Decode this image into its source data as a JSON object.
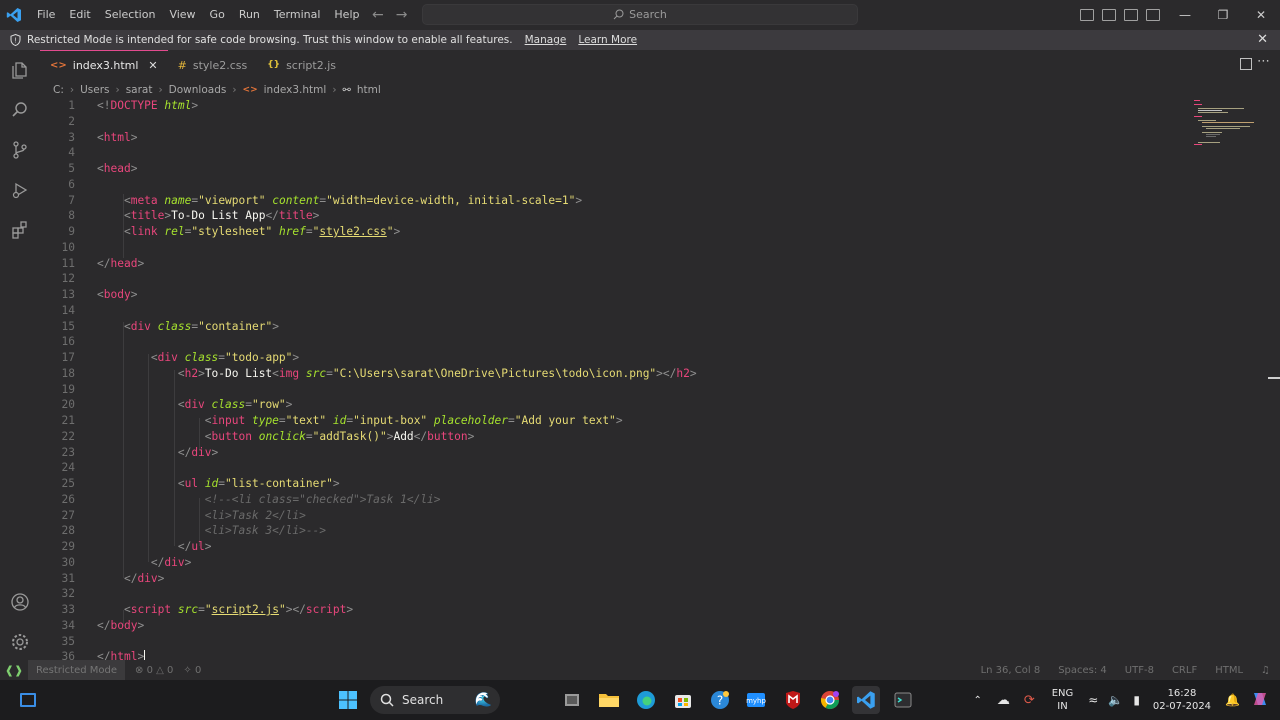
{
  "menu": [
    "File",
    "Edit",
    "Selection",
    "View",
    "Go",
    "Run",
    "Terminal",
    "Help"
  ],
  "search": {
    "label": "Search"
  },
  "banner": {
    "message": "Restricted Mode is intended for safe code browsing. Trust this window to enable all features.",
    "manage": "Manage",
    "learn_more": "Learn More"
  },
  "tabs": [
    {
      "label": "index3.html",
      "icon": "html-icon",
      "active": true
    },
    {
      "label": "style2.css",
      "icon": "css-icon",
      "active": false
    },
    {
      "label": "script2.js",
      "icon": "js-icon",
      "active": false
    }
  ],
  "breadcrumb": [
    "C:",
    "Users",
    "sarat",
    "Downloads",
    "index3.html",
    "html"
  ],
  "editor": {
    "lines": [
      [
        [
          "punc",
          "<!"
        ],
        [
          "tag",
          "DOCTYPE"
        ],
        [
          "txt",
          " "
        ],
        [
          "attr",
          "html"
        ],
        [
          "punc",
          ">"
        ]
      ],
      [],
      [
        [
          "punc",
          "<"
        ],
        [
          "tag",
          "html"
        ],
        [
          "punc",
          ">"
        ]
      ],
      [],
      [
        [
          "punc",
          "<"
        ],
        [
          "tag",
          "head"
        ],
        [
          "punc",
          ">"
        ]
      ],
      [],
      [
        [
          "txt",
          "    "
        ],
        [
          "punc",
          "<"
        ],
        [
          "tag",
          "meta"
        ],
        [
          "txt",
          " "
        ],
        [
          "attr",
          "name"
        ],
        [
          "punc",
          "="
        ],
        [
          "str",
          "\"viewport\""
        ],
        [
          "txt",
          " "
        ],
        [
          "attr",
          "content"
        ],
        [
          "punc",
          "="
        ],
        [
          "str",
          "\"width=device-width, initial-scale=1\""
        ],
        [
          "punc",
          ">"
        ]
      ],
      [
        [
          "txt",
          "    "
        ],
        [
          "punc",
          "<"
        ],
        [
          "tag",
          "title"
        ],
        [
          "punc",
          ">"
        ],
        [
          "txt",
          "To-Do List App"
        ],
        [
          "punc",
          "</"
        ],
        [
          "tag",
          "title"
        ],
        [
          "punc",
          ">"
        ]
      ],
      [
        [
          "txt",
          "    "
        ],
        [
          "punc",
          "<"
        ],
        [
          "tag",
          "link"
        ],
        [
          "txt",
          " "
        ],
        [
          "attr",
          "rel"
        ],
        [
          "punc",
          "="
        ],
        [
          "str",
          "\"stylesheet\""
        ],
        [
          "txt",
          " "
        ],
        [
          "attr",
          "href"
        ],
        [
          "punc",
          "="
        ],
        [
          "str",
          "\""
        ],
        [
          "link",
          "style2.css"
        ],
        [
          "str",
          "\""
        ],
        [
          "punc",
          ">"
        ]
      ],
      [],
      [
        [
          "punc",
          "</"
        ],
        [
          "tag",
          "head"
        ],
        [
          "punc",
          ">"
        ]
      ],
      [],
      [
        [
          "punc",
          "<"
        ],
        [
          "tag",
          "body"
        ],
        [
          "punc",
          ">"
        ]
      ],
      [],
      [
        [
          "txt",
          "    "
        ],
        [
          "punc",
          "<"
        ],
        [
          "tag",
          "div"
        ],
        [
          "txt",
          " "
        ],
        [
          "attr",
          "class"
        ],
        [
          "punc",
          "="
        ],
        [
          "str",
          "\"container\""
        ],
        [
          "punc",
          ">"
        ]
      ],
      [],
      [
        [
          "txt",
          "        "
        ],
        [
          "punc",
          "<"
        ],
        [
          "tag",
          "div"
        ],
        [
          "txt",
          " "
        ],
        [
          "attr",
          "class"
        ],
        [
          "punc",
          "="
        ],
        [
          "str",
          "\"todo-app\""
        ],
        [
          "punc",
          ">"
        ]
      ],
      [
        [
          "txt",
          "            "
        ],
        [
          "punc",
          "<"
        ],
        [
          "tag",
          "h2"
        ],
        [
          "punc",
          ">"
        ],
        [
          "txt",
          "To-Do List"
        ],
        [
          "punc",
          "<"
        ],
        [
          "tag",
          "img"
        ],
        [
          "txt",
          " "
        ],
        [
          "attr",
          "src"
        ],
        [
          "punc",
          "="
        ],
        [
          "str",
          "\"C:\\Users\\sarat\\OneDrive\\Pictures\\todo\\icon.png\""
        ],
        [
          "punc",
          "></"
        ],
        [
          "tag",
          "h2"
        ],
        [
          "punc",
          ">"
        ]
      ],
      [],
      [
        [
          "txt",
          "            "
        ],
        [
          "punc",
          "<"
        ],
        [
          "tag",
          "div"
        ],
        [
          "txt",
          " "
        ],
        [
          "attr",
          "class"
        ],
        [
          "punc",
          "="
        ],
        [
          "str",
          "\"row\""
        ],
        [
          "punc",
          ">"
        ]
      ],
      [
        [
          "txt",
          "                "
        ],
        [
          "punc",
          "<"
        ],
        [
          "tag",
          "input"
        ],
        [
          "txt",
          " "
        ],
        [
          "attr",
          "type"
        ],
        [
          "punc",
          "="
        ],
        [
          "str",
          "\"text\""
        ],
        [
          "txt",
          " "
        ],
        [
          "attr",
          "id"
        ],
        [
          "punc",
          "="
        ],
        [
          "str",
          "\"input-box\""
        ],
        [
          "txt",
          " "
        ],
        [
          "attr",
          "placeholder"
        ],
        [
          "punc",
          "="
        ],
        [
          "str",
          "\"Add your text\""
        ],
        [
          "punc",
          ">"
        ]
      ],
      [
        [
          "txt",
          "                "
        ],
        [
          "punc",
          "<"
        ],
        [
          "tag",
          "button"
        ],
        [
          "txt",
          " "
        ],
        [
          "attr",
          "onclick"
        ],
        [
          "punc",
          "="
        ],
        [
          "str",
          "\"addTask()\""
        ],
        [
          "punc",
          ">"
        ],
        [
          "txt",
          "Add"
        ],
        [
          "punc",
          "</"
        ],
        [
          "tag",
          "button"
        ],
        [
          "punc",
          ">"
        ]
      ],
      [
        [
          "txt",
          "            "
        ],
        [
          "punc",
          "</"
        ],
        [
          "tag",
          "div"
        ],
        [
          "punc",
          ">"
        ]
      ],
      [],
      [
        [
          "txt",
          "            "
        ],
        [
          "punc",
          "<"
        ],
        [
          "tag",
          "ul"
        ],
        [
          "txt",
          " "
        ],
        [
          "attr",
          "id"
        ],
        [
          "punc",
          "="
        ],
        [
          "str",
          "\"list-container\""
        ],
        [
          "punc",
          ">"
        ]
      ],
      [
        [
          "txt",
          "                "
        ],
        [
          "cm",
          "<!--<li class=\"checked\">Task 1</li>"
        ]
      ],
      [
        [
          "txt",
          "                "
        ],
        [
          "cm",
          "<li>Task 2</li>"
        ]
      ],
      [
        [
          "txt",
          "                "
        ],
        [
          "cm",
          "<li>Task 3</li>-->"
        ]
      ],
      [
        [
          "txt",
          "            "
        ],
        [
          "punc",
          "</"
        ],
        [
          "tag",
          "ul"
        ],
        [
          "punc",
          ">"
        ]
      ],
      [
        [
          "txt",
          "        "
        ],
        [
          "punc",
          "</"
        ],
        [
          "tag",
          "div"
        ],
        [
          "punc",
          ">"
        ]
      ],
      [
        [
          "txt",
          "    "
        ],
        [
          "punc",
          "</"
        ],
        [
          "tag",
          "div"
        ],
        [
          "punc",
          ">"
        ]
      ],
      [],
      [
        [
          "txt",
          "    "
        ],
        [
          "punc",
          "<"
        ],
        [
          "tag",
          "script"
        ],
        [
          "txt",
          " "
        ],
        [
          "attr",
          "src"
        ],
        [
          "punc",
          "="
        ],
        [
          "str",
          "\""
        ],
        [
          "link",
          "script2.js"
        ],
        [
          "str",
          "\""
        ],
        [
          "punc",
          "></"
        ],
        [
          "tag",
          "script"
        ],
        [
          "punc",
          ">"
        ]
      ],
      [
        [
          "punc",
          "</"
        ],
        [
          "tag",
          "body"
        ],
        [
          "punc",
          ">"
        ]
      ],
      [],
      [
        [
          "punc",
          "</"
        ],
        [
          "tag",
          "html"
        ],
        [
          "punc",
          ">"
        ]
      ]
    ]
  },
  "statusbar": {
    "restricted": "Restricted Mode",
    "errors": "0",
    "warnings": "0",
    "ports": "0",
    "position": "Ln 36, Col 8",
    "spaces": "Spaces: 4",
    "encoding": "UTF-8",
    "eol": "CRLF",
    "language": "HTML"
  },
  "taskbar": {
    "search": "Search",
    "lang_top": "ENG",
    "lang_bottom": "IN",
    "time": "16:28",
    "date": "02-07-2024"
  },
  "colors": {
    "accent": "#e24b8e",
    "tag": "#e8467c",
    "attr": "#a6e22e",
    "string": "#e6db74"
  }
}
